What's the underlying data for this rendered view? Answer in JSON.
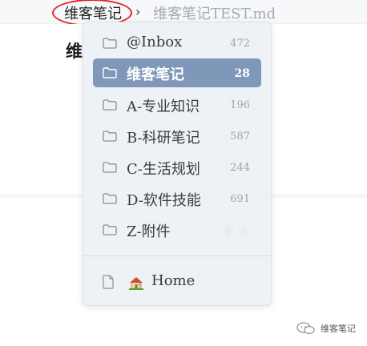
{
  "breadcrumb": {
    "root_label": "维客笔记",
    "separator": "›",
    "file_label": "维客笔记TEST.md"
  },
  "editor": {
    "heading_text": "维"
  },
  "dropdown": {
    "items": [
      {
        "label": "@Inbox",
        "count": "472",
        "active": false,
        "icon": "folder-icon"
      },
      {
        "label": "维客笔记",
        "count": "28",
        "active": true,
        "icon": "folder-icon"
      },
      {
        "label": "A-专业知识",
        "count": "196",
        "active": false,
        "icon": "folder-icon"
      },
      {
        "label": "B-科研笔记",
        "count": "587",
        "active": false,
        "icon": "folder-icon"
      },
      {
        "label": "C-生活规划",
        "count": "244",
        "active": false,
        "icon": "folder-icon"
      },
      {
        "label": "D-软件技能",
        "count": "691",
        "active": false,
        "icon": "folder-icon"
      },
      {
        "label": "Z-附件",
        "count": "",
        "active": false,
        "icon": "folder-icon"
      }
    ],
    "home": {
      "label": "Home",
      "file_icon": "file-icon",
      "emoji_icon": "house-icon"
    }
  },
  "watermark": {
    "text": "维客笔记",
    "icon": "wechat-icon"
  },
  "colors": {
    "active_bg": "#7f98ba",
    "menu_bg": "#eef1f6",
    "annotation_ring": "#e0262a"
  }
}
